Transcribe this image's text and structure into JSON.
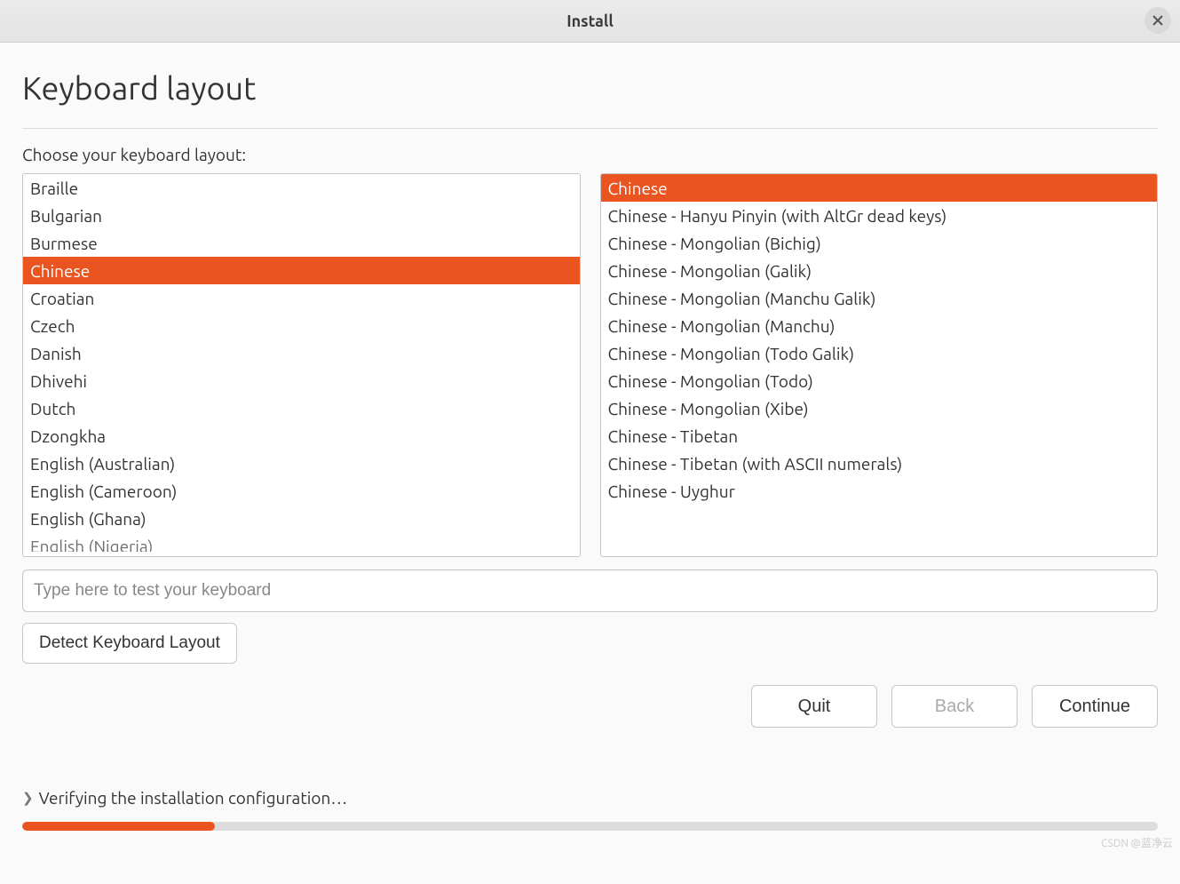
{
  "window": {
    "title": "Install"
  },
  "page": {
    "heading": "Keyboard layout",
    "prompt": "Choose your keyboard layout:"
  },
  "layouts": [
    {
      "label": "Braille",
      "selected": false
    },
    {
      "label": "Bulgarian",
      "selected": false
    },
    {
      "label": "Burmese",
      "selected": false
    },
    {
      "label": "Chinese",
      "selected": true
    },
    {
      "label": "Croatian",
      "selected": false
    },
    {
      "label": "Czech",
      "selected": false
    },
    {
      "label": "Danish",
      "selected": false
    },
    {
      "label": "Dhivehi",
      "selected": false
    },
    {
      "label": "Dutch",
      "selected": false
    },
    {
      "label": "Dzongkha",
      "selected": false
    },
    {
      "label": "English (Australian)",
      "selected": false
    },
    {
      "label": "English (Cameroon)",
      "selected": false
    },
    {
      "label": "English (Ghana)",
      "selected": false
    },
    {
      "label": "English (Nigeria)",
      "selected": false,
      "cutoff": true
    }
  ],
  "variants": [
    {
      "label": "Chinese",
      "selected": true
    },
    {
      "label": "Chinese - Hanyu Pinyin (with AltGr dead keys)",
      "selected": false
    },
    {
      "label": "Chinese - Mongolian (Bichig)",
      "selected": false
    },
    {
      "label": "Chinese - Mongolian (Galik)",
      "selected": false
    },
    {
      "label": "Chinese - Mongolian (Manchu Galik)",
      "selected": false
    },
    {
      "label": "Chinese - Mongolian (Manchu)",
      "selected": false
    },
    {
      "label": "Chinese - Mongolian (Todo Galik)",
      "selected": false
    },
    {
      "label": "Chinese - Mongolian (Todo)",
      "selected": false
    },
    {
      "label": "Chinese - Mongolian (Xibe)",
      "selected": false
    },
    {
      "label": "Chinese - Tibetan",
      "selected": false
    },
    {
      "label": "Chinese - Tibetan (with ASCII numerals)",
      "selected": false
    },
    {
      "label": "Chinese - Uyghur",
      "selected": false
    }
  ],
  "test_input": {
    "placeholder": "Type here to test your keyboard",
    "value": ""
  },
  "buttons": {
    "detect": "Detect Keyboard Layout",
    "quit": "Quit",
    "back": "Back",
    "continue": "Continue"
  },
  "status": {
    "text": "Verifying the installation configuration…",
    "progress_percent": 17
  },
  "watermark": "CSDN @蓝净云"
}
